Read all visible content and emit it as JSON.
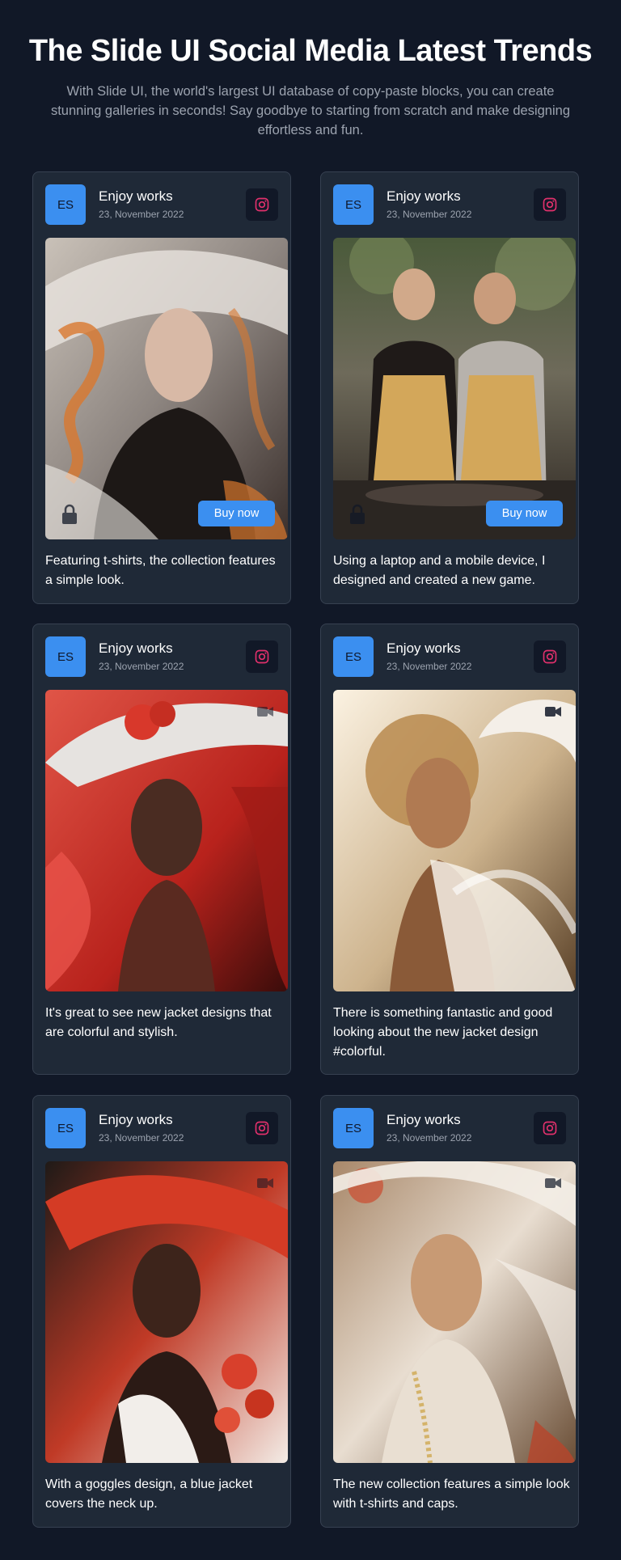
{
  "header": {
    "title": "The Slide UI Social Media Latest Trends",
    "subtitle": "With Slide UI, the world's largest UI database of copy-paste blocks, you can create stunning galleries in seconds! Say goodbye to starting from scratch and make designing effortless and fun."
  },
  "colors": {
    "accent": "#3b8ff0",
    "background": "#111827",
    "card": "#1f2937",
    "instagram": "#e1306c"
  },
  "cards": [
    {
      "avatar": "ES",
      "name": "Enjoy works",
      "date": "23, November 2022",
      "social_icon": "instagram-icon",
      "media": "woman-flowing-hair-photo",
      "buy_label": "Buy now",
      "caption": "Featuring t-shirts, the collection features a simple look."
    },
    {
      "avatar": "ES",
      "name": "Enjoy works",
      "date": "23, November 2022",
      "social_icon": "instagram-icon",
      "media": "couple-cooking-photo",
      "buy_label": "Buy now",
      "caption": "Using a laptop and a mobile device, I designed and created a new game."
    },
    {
      "avatar": "ES",
      "name": "Enjoy works",
      "date": "23, November 2022",
      "social_icon": "instagram-icon",
      "media": "woman-red-hat-photo",
      "caption": "It's great to see new jacket designs that are colorful and stylish."
    },
    {
      "avatar": "ES",
      "name": "Enjoy works",
      "date": "23, November 2022",
      "social_icon": "instagram-icon",
      "media": "woman-white-veil-photo",
      "caption": "There is something fantastic and good looking about the new jacket design #colorful."
    },
    {
      "avatar": "ES",
      "name": "Enjoy works",
      "date": "23, November 2022",
      "social_icon": "instagram-icon",
      "media": "woman-red-hat-roses-photo",
      "caption": "With a goggles design, a blue jacket covers the neck up."
    },
    {
      "avatar": "ES",
      "name": "Enjoy works",
      "date": "23, November 2022",
      "social_icon": "instagram-icon",
      "media": "woman-sheer-veil-photo",
      "caption": "The new collection features a simple look with t-shirts and caps."
    }
  ]
}
